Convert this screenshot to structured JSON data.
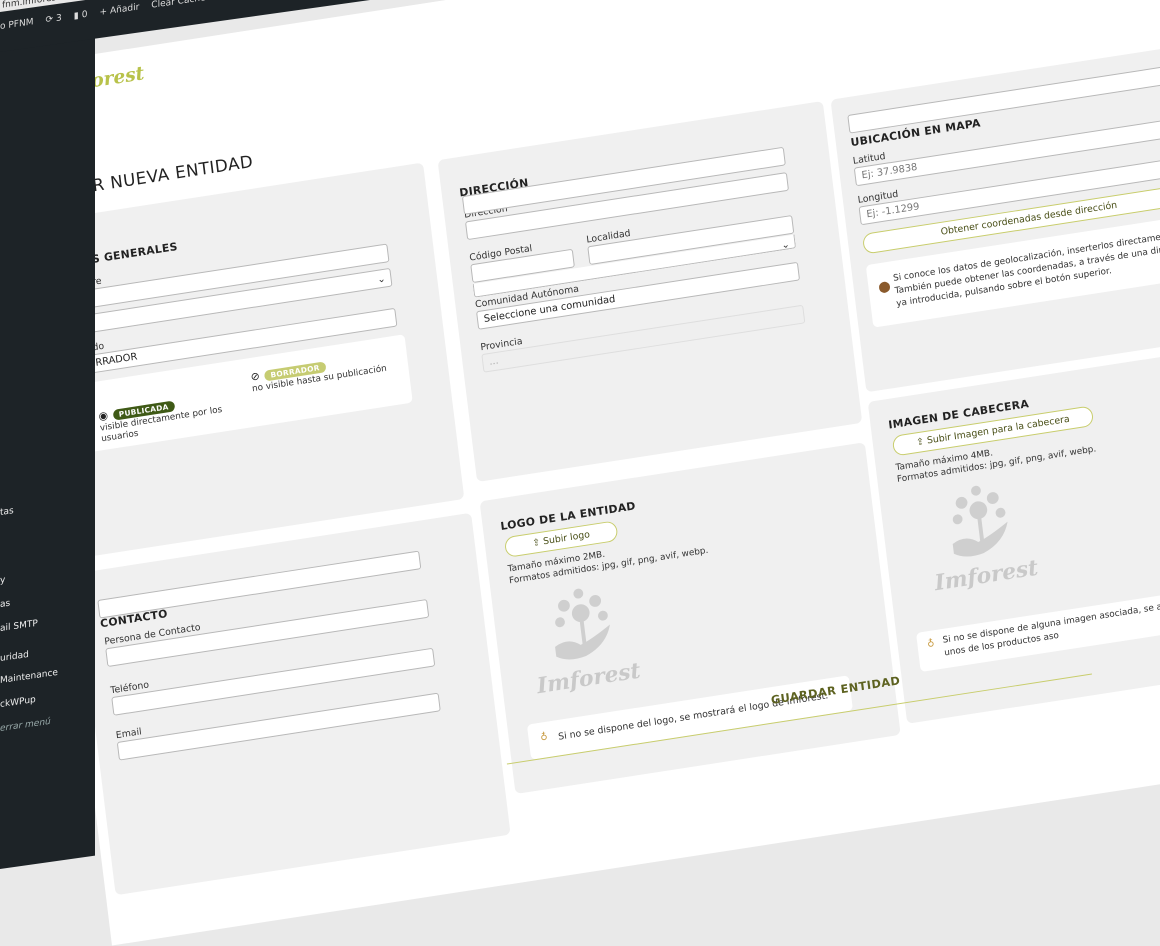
{
  "admin_bar": {
    "url": "fnm.imforest.es/wp-ad",
    "site": "o PFNM",
    "updates": "3",
    "comments": "0",
    "add_new": "Añadir",
    "cache": "Clear Cache For Me"
  },
  "sidebar": {
    "items": [
      "tas",
      "y",
      "as",
      "ail SMTP",
      "uridad",
      " Maintenance",
      "ckWPup",
      "errar menú"
    ]
  },
  "logo": {
    "word": "Imforest"
  },
  "page_title": "AÑADIR NUEVA ENTIDAD",
  "datos_generales": {
    "title": "DATOS GENERALES",
    "nombre_label": "Nombre",
    "estado_label": "Estado",
    "estado_value": "BORRADOR",
    "publicada_badge": "PUBLICADA",
    "publicada_desc": "visible directamente por los usuarios",
    "borrador_badge": "BORRADOR",
    "borrador_desc": "no visible hasta su publicación"
  },
  "direccion": {
    "title": "DIRECCIÓN",
    "direccion_label": "Dirección",
    "cp_label": "Código Postal",
    "localidad_label": "Localidad",
    "ccaa_label": "Comunidad Autónoma",
    "ccaa_value": "Seleccione una comunidad",
    "provincia_label": "Provincia",
    "provincia_value": "..."
  },
  "ubicacion": {
    "title": "UBICACIÓN EN MAPA",
    "lat_label": "Latitud",
    "lat_placeholder": "Ej: 37.9838",
    "lng_label": "Longitud",
    "lng_placeholder": "Ej: -1.1299",
    "button": "Obtener coordenadas desde dirección",
    "hint": "Si conoce los datos de geolocalización, inserterlos directamente. También puede obtener las coordenadas, a través de una dirección ya introducida, pulsando sobre el botón superior."
  },
  "contacto": {
    "title": "CONTACTO",
    "persona_label": "Persona de Contacto",
    "telefono_label": "Teléfono",
    "email_label": "Email"
  },
  "logo_entidad": {
    "title": "LOGO DE LA ENTIDAD",
    "button": "Subir logo",
    "size": "Tamaño máximo 2MB.",
    "formats": "Formatos admitidos: jpg, gif, png, avif, webp.",
    "placeholder_word": "Imforest",
    "hint": "Si no se dispone del logo, se mostrará el logo de Imforest."
  },
  "imagen_cabecera": {
    "title": "IMAGEN DE CABECERA",
    "button": "Subir Imagen para la cabecera",
    "size": "Tamaño máximo 4MB.",
    "formats": "Formatos admitidos: jpg, gif, png, avif, webp.",
    "placeholder_word": "Imforest",
    "hint": "Si no se dispone de alguna imagen asociada, se aleatoria relacionada con unos de los productos aso"
  },
  "save_button": "GUARDAR ENTIDAD",
  "colors": {
    "accent": "#b8c24a",
    "badge_publicada": "#3f5a16",
    "badge_borrador": "#c6cc72",
    "admin_dark": "#1d2327"
  }
}
